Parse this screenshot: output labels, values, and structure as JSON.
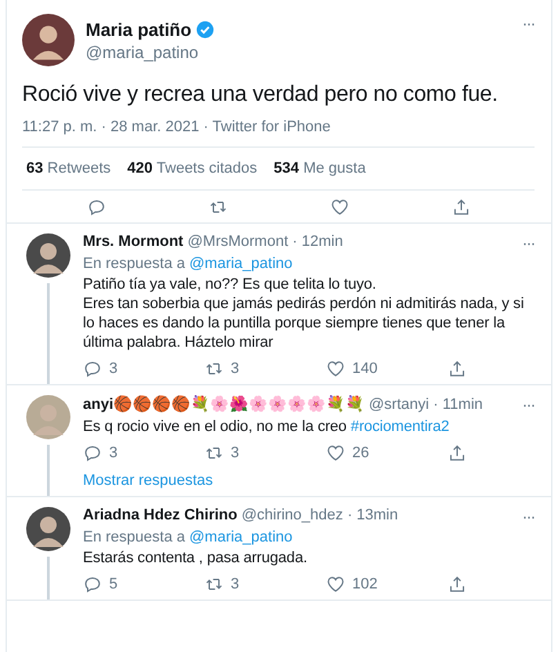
{
  "tweet": {
    "name": "Maria patiño",
    "verified": true,
    "handle": "@maria_patino",
    "text": "Roció vive y recrea una verdad pero no como fue.",
    "meta": "11:27 p. m. · 28 mar. 2021 · Twitter for iPhone",
    "stats": [
      {
        "count": "63",
        "label": "Retweets"
      },
      {
        "count": "420",
        "label": "Tweets citados"
      },
      {
        "count": "534",
        "label": "Me gusta"
      }
    ],
    "more": "···"
  },
  "replies": [
    {
      "name": "Mrs. Mormont",
      "handle": "@MrsMormont · 12min",
      "replying_label": "En respuesta a",
      "replying_to": "@maria_patino",
      "text": "Patiño tía ya vale, no?? Es que telita lo tuyo.\nEres tan soberbia que jamás pedirás perdón ni admitirás nada, y si lo haces es dando la puntilla porque siempre tienes que tener la última palabra. Háztelo mirar",
      "replies": "3",
      "retweets": "3",
      "likes": "140",
      "more": "···"
    },
    {
      "name": "anyi🏀🏀🏀🏀💐🌸🌺🌸🌸🌸🌸💐💐",
      "handle": "@srtanyi · 11min",
      "text": "Es q rocio vive en el odio, no me la creo",
      "hashtag": "#rociomentira2",
      "replies": "3",
      "retweets": "3",
      "likes": "26",
      "more": "···",
      "show_replies": "Mostrar respuestas"
    },
    {
      "name": "Ariadna Hdez Chirino",
      "handle": "@chirino_hdez · 13min",
      "replying_label": "En respuesta a",
      "replying_to": "@maria_patino",
      "text": "Estarás contenta , pasa arrugada.",
      "replies": "5",
      "retweets": "3",
      "likes": "102",
      "more": "···"
    }
  ]
}
